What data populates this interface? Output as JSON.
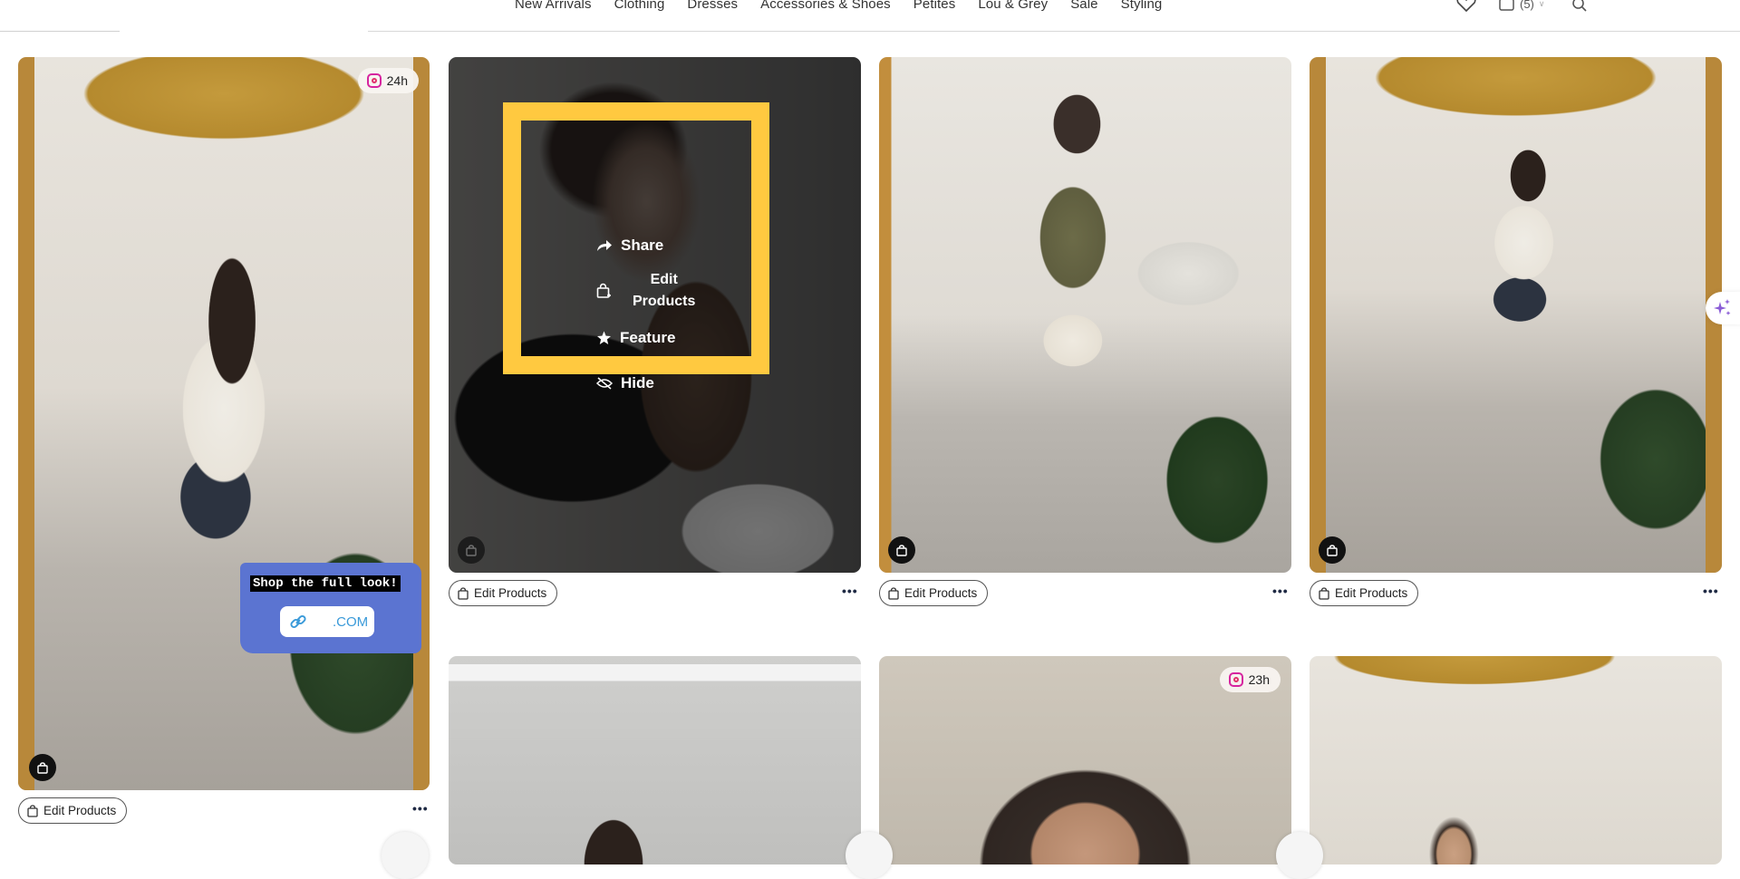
{
  "nav": {
    "items": [
      "New Arrivals",
      "Clothing",
      "Dresses",
      "Accessories & Shoes",
      "Petites",
      "Lou & Grey",
      "Sale",
      "Styling"
    ],
    "bag_count": "(5)",
    "icons": [
      "heart-icon",
      "shopping-bag-icon",
      "chevron-down-icon",
      "search-icon"
    ]
  },
  "cards": [
    {
      "id": "card-1",
      "badge": "24h",
      "sticker": {
        "text": "Shop the full look!",
        "link_suffix": ".COM"
      },
      "edit_label": "Edit Products"
    },
    {
      "id": "card-2",
      "edit_label": "Edit Products",
      "hover_menu": {
        "items": [
          {
            "icon": "share-icon",
            "label": "Share"
          },
          {
            "icon": "edit-bag-icon",
            "label_line1": "Edit",
            "label_line2": "Products"
          },
          {
            "icon": "star-icon",
            "label": "Feature"
          },
          {
            "icon": "eye-off-icon",
            "label": "Hide"
          }
        ]
      }
    },
    {
      "id": "card-3",
      "edit_label": "Edit Products"
    },
    {
      "id": "card-4",
      "edit_label": "Edit Products"
    },
    {
      "id": "card-6",
      "badge": "23h"
    }
  ],
  "colors": {
    "highlight": "#ffc940",
    "sticker": "#5b74d1",
    "sparkle": "#8a5cd6"
  }
}
